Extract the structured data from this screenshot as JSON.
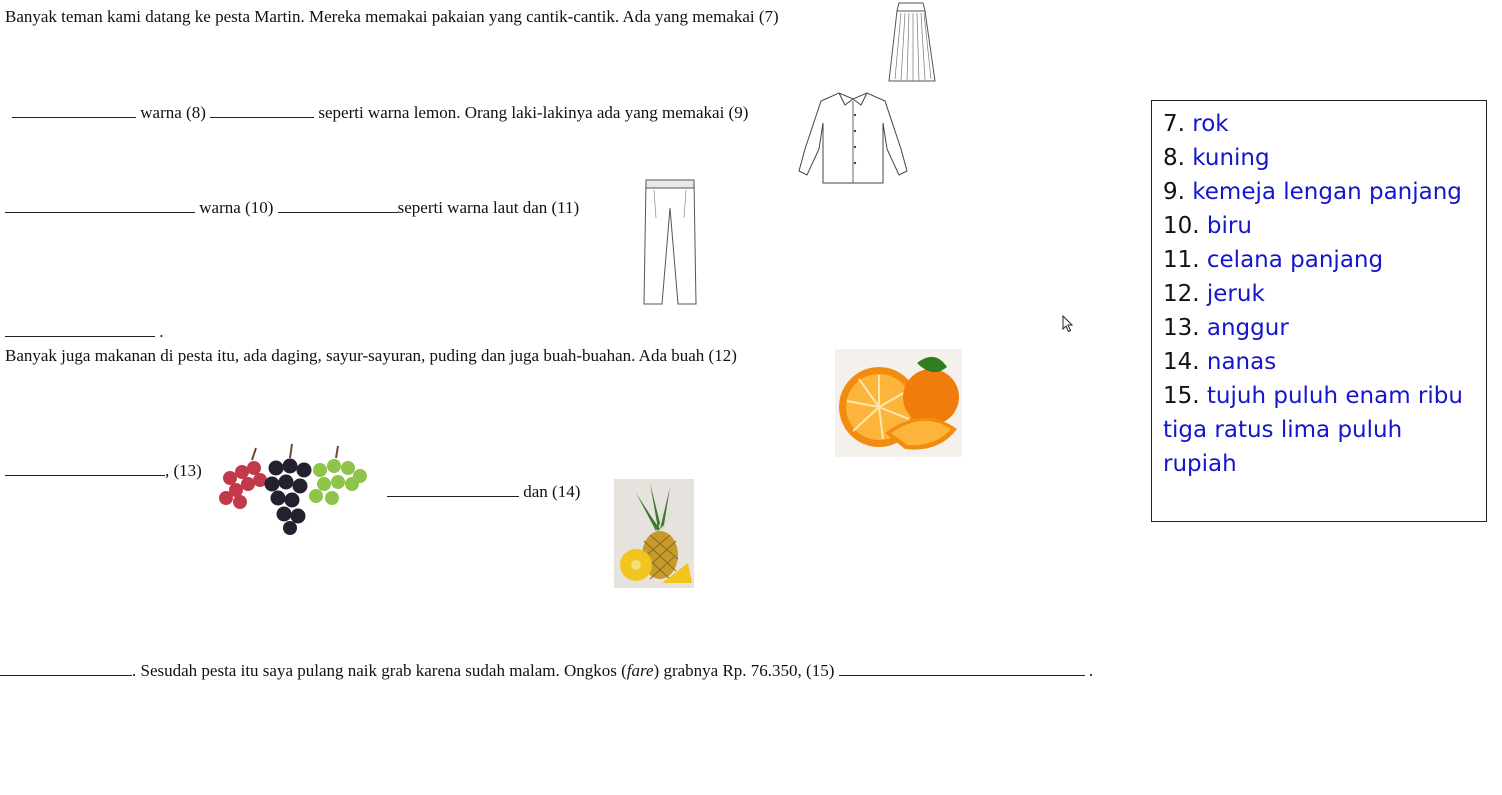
{
  "paragraph1": {
    "line1": "Banyak teman kami datang ke pesta Martin. Mereka memakai pakaian yang cantik-cantik. Ada yang memakai (7)",
    "line2_a": "warna (8)",
    "line2_b": "seperti warna lemon. Orang laki-lakinya ada yang memakai (9)",
    "line3_a": "warna (10)",
    "line3_b": "seperti warna laut dan (11)",
    "line4_end": "."
  },
  "paragraph2": {
    "line1": "Banyak juga makanan di pesta itu, ada daging, sayur-sayuran, puding dan juga buah-buahan. Ada buah (12)",
    "line2_a": ", (13)",
    "line2_b": "dan (14)",
    "line3_a": ". Sesudah pesta itu saya pulang naik grab karena sudah malam. Ongkos (",
    "line3_italic": "fare",
    "line3_b": ") grabnya Rp. 76.350, (15)",
    "line3_end": "."
  },
  "images": {
    "skirt": "skirt-icon",
    "shirt": "long-sleeve-shirt-icon",
    "pants": "trousers-icon",
    "orange": "orange-fruit-image",
    "grapes": "grapes-image",
    "pineapple": "pineapple-image"
  },
  "answers": [
    {
      "num": "7.",
      "text": "rok"
    },
    {
      "num": "8.",
      "text": "kuning"
    },
    {
      "num": "9.",
      "text": "kemeja lengan panjang"
    },
    {
      "num": "10.",
      "text": "biru"
    },
    {
      "num": "11.",
      "text": "celana panjang"
    },
    {
      "num": "12.",
      "text": "jeruk"
    },
    {
      "num": "13.",
      "text": "anggur"
    },
    {
      "num": "14.",
      "text": "nanas"
    },
    {
      "num": "15.",
      "text": "tujuh puluh enam ribu tiga ratus lima puluh rupiah"
    }
  ],
  "colors": {
    "answer_text": "#1515cc",
    "text": "#111111"
  }
}
